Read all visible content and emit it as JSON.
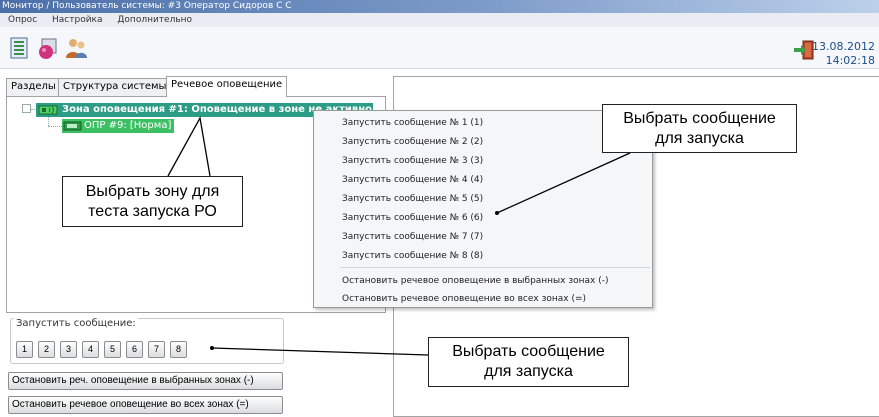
{
  "window": {
    "title": "Монитор / Пользователь системы: #3 Оператор Сидоров С С"
  },
  "menu": {
    "items": [
      "Опрос",
      "Настройка",
      "Дополнительно"
    ]
  },
  "toolbar": {
    "icons": [
      "list-icon",
      "devices-icon",
      "users-icon"
    ],
    "exit_icon": "exit-icon",
    "date": "13.08.2012",
    "time": "14:02:18"
  },
  "tabs": [
    "Разделы",
    "Структура системы",
    "Речевое оповещение"
  ],
  "active_tab": "Речевое оповещение",
  "tree": {
    "zone_label": "Зона оповещения #1: Оповещение в зоне не активно",
    "opr_label": "ОПР #9: [Норма]",
    "zone_color": "#2c9c86",
    "opr_color": "#3cc063"
  },
  "context_menu": {
    "items": [
      "Запустить сообщение № 1 (1)",
      "Запустить сообщение № 2 (2)",
      "Запустить сообщение № 3 (3)",
      "Запустить сообщение № 4 (4)",
      "Запустить сообщение № 5 (5)",
      "Запустить сообщение № 6 (6)",
      "Запустить сообщение № 7 (7)",
      "Запустить сообщение № 8 (8)"
    ],
    "stop_items": [
      "Остановить речевое оповещение в выбранных зонах (-)",
      "Остановить речевое оповещение во всех зонах (=)"
    ]
  },
  "launch": {
    "label": "Запустить сообщение:",
    "buttons": [
      "1",
      "2",
      "3",
      "4",
      "5",
      "6",
      "7",
      "8"
    ],
    "stop_selected": "Остановить реч. оповещение в выбранных зонах (-)",
    "stop_all": "Остановить речевое оповещение во всех зонах (=)"
  },
  "callouts": {
    "zone_line1": "Выбрать зону для",
    "zone_line2": "теста запуска РО",
    "menu_line1": "Выбрать сообщение",
    "menu_line2": "для запуска",
    "buttons_line1": "Выбрать сообщение",
    "buttons_line2": "для запуска"
  }
}
